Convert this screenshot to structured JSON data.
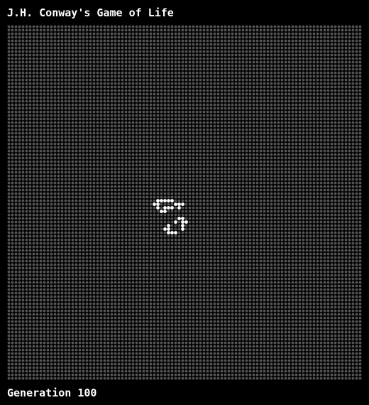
{
  "app": {
    "title": "J.H. Conway's Game of Life"
  },
  "status": {
    "generation_text": "Generation 100"
  },
  "board": {
    "columns": 100,
    "rows": 100,
    "dead_color": "#555555",
    "live_color": "#ffffff",
    "background_color": "#000000",
    "live_cells": [
      [
        42,
        49
      ],
      [
        43,
        49
      ],
      [
        44,
        49
      ],
      [
        45,
        49
      ],
      [
        46,
        49
      ],
      [
        41,
        50
      ],
      [
        42,
        50
      ],
      [
        47,
        50
      ],
      [
        48,
        50
      ],
      [
        49,
        50
      ],
      [
        42,
        51
      ],
      [
        44,
        51
      ],
      [
        45,
        51
      ],
      [
        46,
        51
      ],
      [
        48,
        51
      ],
      [
        43,
        52
      ],
      [
        44,
        52
      ],
      [
        48,
        54
      ],
      [
        49,
        54
      ],
      [
        47,
        55
      ],
      [
        49,
        55
      ],
      [
        50,
        55
      ],
      [
        45,
        56
      ],
      [
        49,
        56
      ],
      [
        44,
        57
      ],
      [
        45,
        57
      ],
      [
        49,
        57
      ],
      [
        45,
        58
      ],
      [
        46,
        58
      ],
      [
        47,
        58
      ]
    ]
  }
}
